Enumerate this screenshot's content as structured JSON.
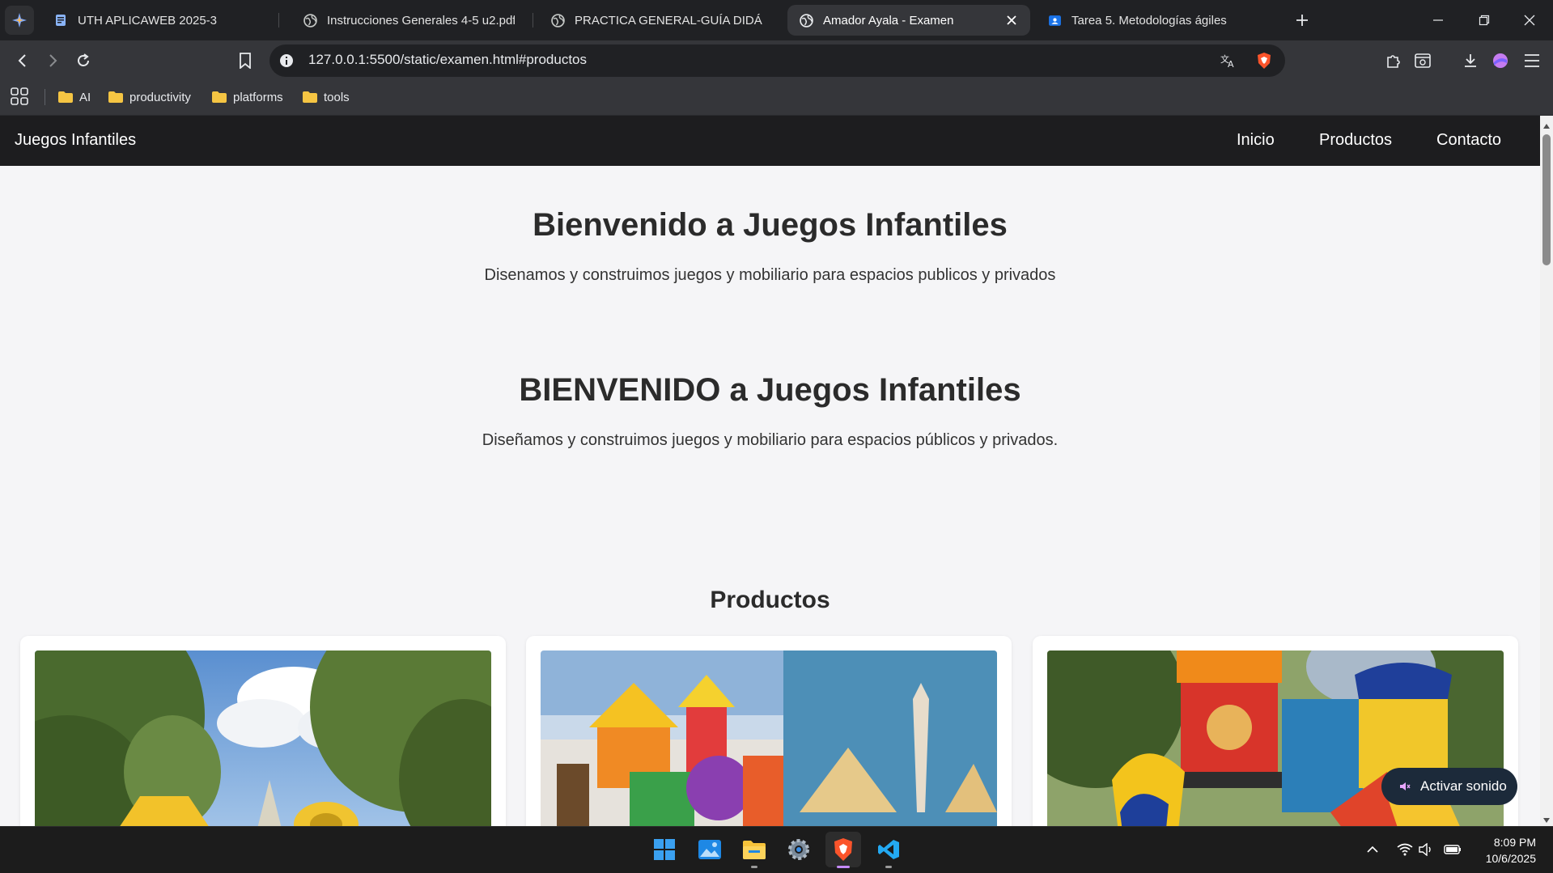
{
  "browser": {
    "tabs": [
      {
        "title": "UTH APLICAWEB 2025-3",
        "favicon": "doc-icon",
        "active": false
      },
      {
        "title": "Instrucciones Generales 4-5 u2.pdf",
        "favicon": "globe-icon",
        "active": false
      },
      {
        "title": "PRACTICA GENERAL-GUÍA DIDÁCTICA",
        "favicon": "globe-icon",
        "active": false
      },
      {
        "title": "Amador Ayala - Examen",
        "favicon": "globe-icon",
        "active": true
      },
      {
        "title": "Tarea 5. Metodologías ágiles",
        "favicon": "classroom-icon",
        "active": false
      }
    ],
    "url": "127.0.0.1:5500/static/examen.html#productos",
    "bookmarks": [
      {
        "label": "AI"
      },
      {
        "label": "productivity"
      },
      {
        "label": "platforms"
      },
      {
        "label": "tools"
      }
    ]
  },
  "page": {
    "nav": {
      "brand": "Juegos Infantiles",
      "links": [
        "Inicio",
        "Productos",
        "Contacto"
      ]
    },
    "hero": {
      "title": "Bienvenido a Juegos Infantiles",
      "subtitle": "Disenamos y construimos juegos y mobiliario para espacios publicos y privados"
    },
    "hero2": {
      "title": "BIENVENIDO a Juegos Infantiles",
      "subtitle": "Diseñamos y construimos juegos y mobiliario para espacios públicos y privados."
    },
    "products": {
      "title": "Productos",
      "images": [
        "playground-photo-1",
        "playground-photo-2",
        "playground-photo-3"
      ]
    },
    "sound_button": "Activar sonido"
  },
  "taskbar": {
    "apps": [
      "windows-start-icon",
      "photos-icon",
      "file-explorer-icon",
      "settings-icon",
      "brave-icon",
      "vscode-icon"
    ],
    "time": "8:09 PM",
    "date": "10/6/2025"
  },
  "colors": {
    "nav_bg": "#1d1d1f",
    "page_bg": "#f5f5f7",
    "brave_orange": "#fb542b",
    "vscode_blue": "#23a9f2"
  }
}
